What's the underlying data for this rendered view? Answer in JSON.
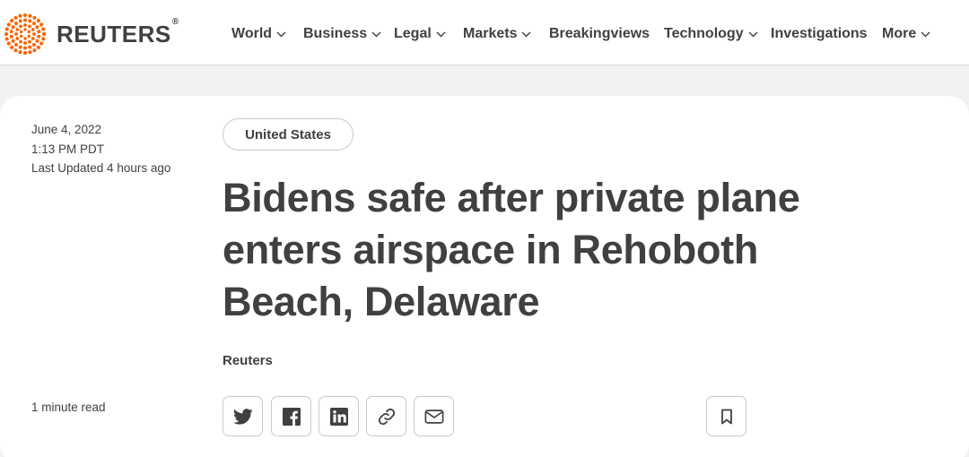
{
  "header": {
    "brand": "REUTERS",
    "brand_mark": "®",
    "nav": [
      {
        "label": "World",
        "dropdown": true
      },
      {
        "label": "Business",
        "dropdown": true
      },
      {
        "label": "Legal",
        "dropdown": true
      },
      {
        "label": "Markets",
        "dropdown": true
      },
      {
        "label": "Breakingviews",
        "dropdown": false
      },
      {
        "label": "Technology",
        "dropdown": true
      },
      {
        "label": "Investigations",
        "dropdown": false
      },
      {
        "label": "More",
        "dropdown": true
      }
    ]
  },
  "article": {
    "date": "June 4, 2022",
    "time": "1:13 PM PDT",
    "last_updated": "Last Updated 4 hours ago",
    "tag": "United States",
    "headline": "Bidens safe after private plane enters airspace in Rehoboth Beach, Delaware",
    "byline": "Reuters",
    "read_time": "1 minute read"
  },
  "share": {
    "icons": [
      "twitter-icon",
      "facebook-icon",
      "linkedin-icon",
      "link-icon",
      "email-icon"
    ],
    "bookmark_icon": "bookmark-icon"
  },
  "colors": {
    "brand_orange": "#fa6400",
    "text": "#404040",
    "page_bg": "#f2f2f2",
    "card_bg": "#ffffff",
    "border": "#c9c9c9"
  }
}
